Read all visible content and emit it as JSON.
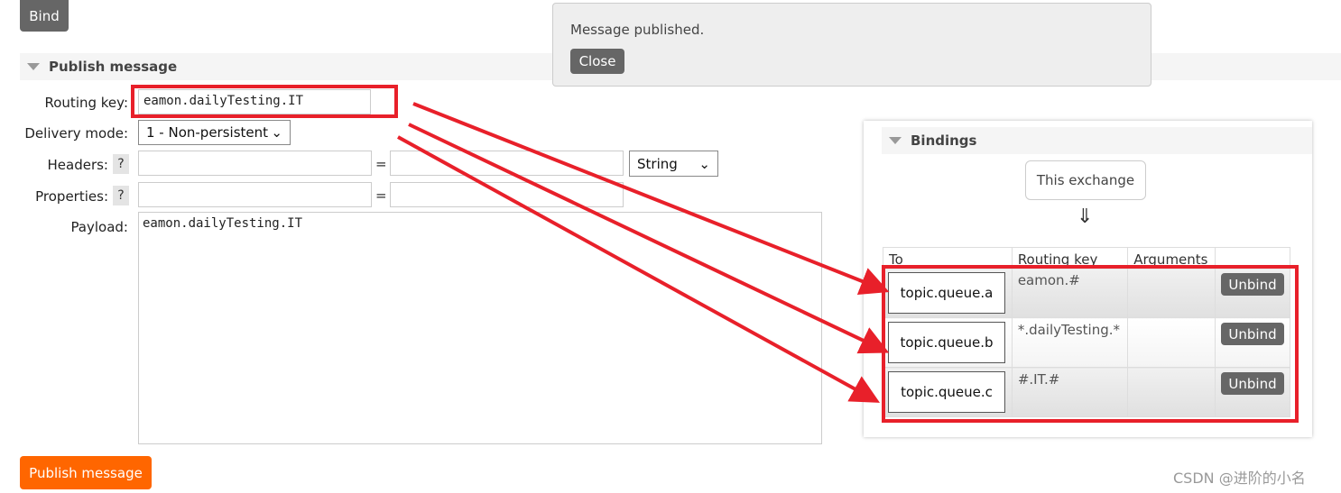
{
  "bind_button": "Bind",
  "publish": {
    "title": "Publish message",
    "routing_key_label": "Routing key:",
    "routing_key_value": "eamon.dailyTesting.IT",
    "delivery_mode_label": "Delivery mode:",
    "delivery_mode_value": "1 - Non-persistent",
    "headers_label": "Headers:",
    "properties_label": "Properties:",
    "help": "?",
    "equals": "=",
    "header_type_value": "String",
    "payload_label": "Payload:",
    "payload_value": "eamon.dailyTesting.IT",
    "submit": "Publish message"
  },
  "notification": {
    "message": "Message published.",
    "close": "Close"
  },
  "bindings": {
    "title": "Bindings",
    "source": "This exchange",
    "arrow": "⇓",
    "columns": [
      "To",
      "Routing key",
      "Arguments",
      ""
    ],
    "rows": [
      {
        "to": "topic.queue.a",
        "key": "eamon.#",
        "args": "",
        "action": "Unbind"
      },
      {
        "to": "topic.queue.b",
        "key": "*.dailyTesting.*",
        "args": "",
        "action": "Unbind"
      },
      {
        "to": "topic.queue.c",
        "key": "#.IT.#",
        "args": "",
        "action": "Unbind"
      }
    ]
  },
  "watermark": "CSDN @进阶的小名",
  "colors": {
    "annotation": "#e8202a",
    "publish_button": "#ff6600",
    "grey_button": "#666666"
  }
}
